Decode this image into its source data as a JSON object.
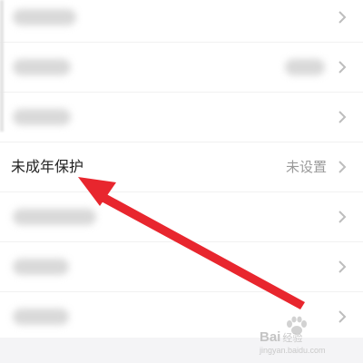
{
  "rows": [
    {
      "label": "",
      "value": ""
    },
    {
      "label": "",
      "value": ""
    },
    {
      "label": "",
      "value": ""
    },
    {
      "label": "未成年保护",
      "value": "未设置"
    },
    {
      "label": "",
      "value": ""
    },
    {
      "label": "",
      "value": ""
    },
    {
      "label": "",
      "value": ""
    }
  ],
  "icons": {
    "chevron": "chevron-right-icon",
    "annotation": "red-arrow",
    "watermark": "paw-icon"
  },
  "colors": {
    "arrow": "#e8262e",
    "label": "#222222",
    "value": "#9a9a9a",
    "chevron": "#bdbdbd"
  },
  "watermark": {
    "brand": "Bai",
    "suffix": "经验",
    "domain": "jingyan.baidu.com"
  }
}
